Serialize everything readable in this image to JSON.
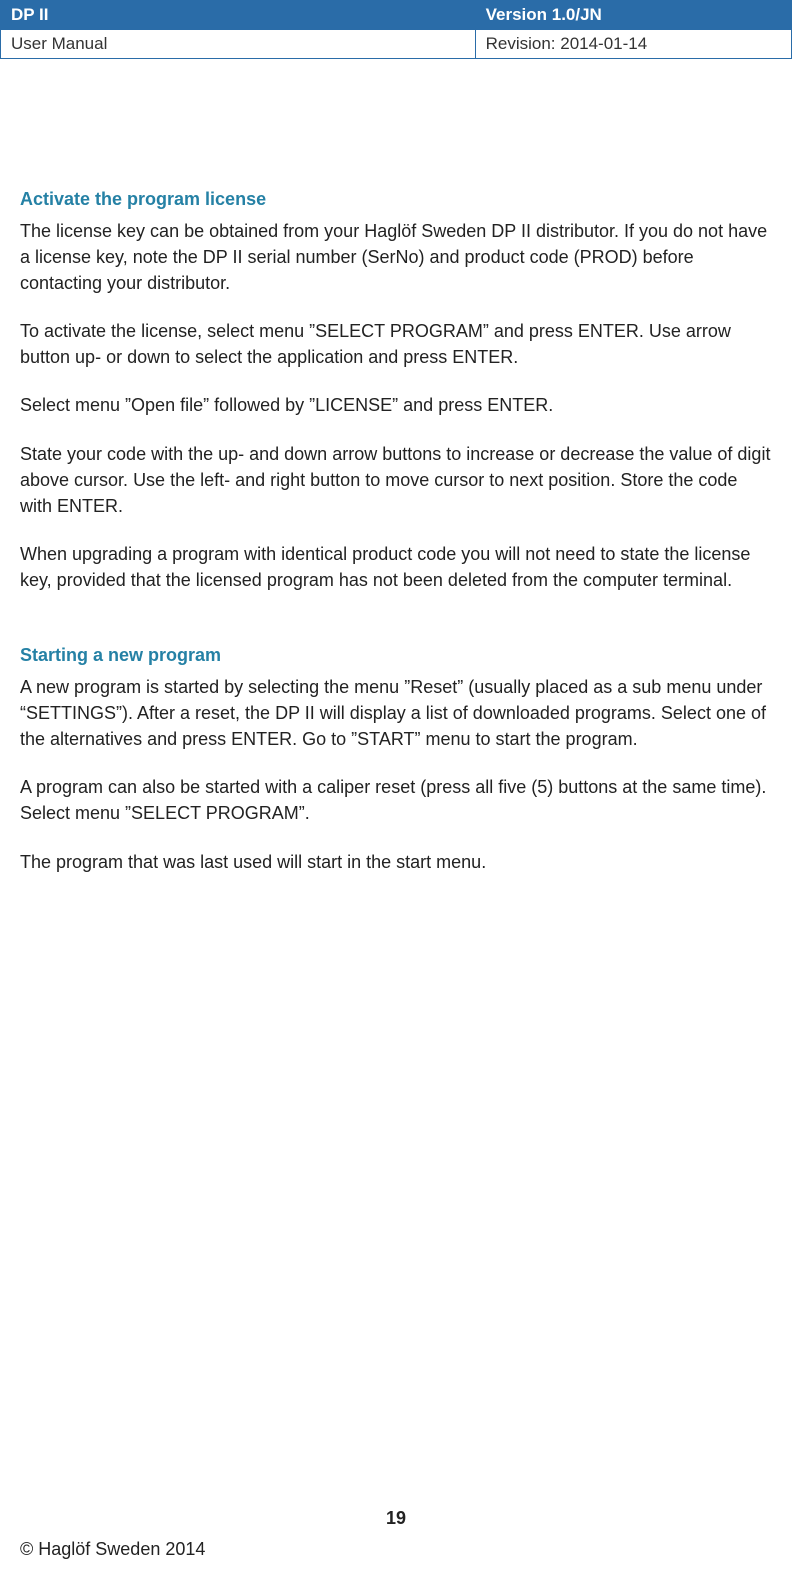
{
  "header": {
    "title": "DP II",
    "version": "Version 1.0/JN",
    "doc_type": "User Manual",
    "revision": "Revision: 2014-01-14"
  },
  "sections": [
    {
      "heading": "Activate the program license",
      "paragraphs": [
        "The license key can be obtained from your Haglöf Sweden DP II distributor. If you do not have a license key, note the DP II serial number (SerNo) and product code (PROD) before contacting your distributor.",
        "To activate the license, select menu ”SELECT PROGRAM” and press ENTER. Use arrow button up- or down to select the application and press ENTER.",
        "Select menu ”Open file” followed by ”LICENSE” and press ENTER.",
        "State your code with the up- and down arrow buttons to increase or decrease the value of digit above cursor. Use the left- and right button to move cursor to next position. Store the code with ENTER.",
        "When upgrading a program with identical product code you will not need to state the license key, provided that the licensed program has not been deleted from the computer terminal."
      ]
    },
    {
      "heading": "Starting a new program",
      "paragraphs": [
        "A new program is started by selecting the menu ”Reset” (usually placed as a sub menu under “SETTINGS”). After a reset, the DP II will display a list of downloaded programs. Select one of the alternatives and press ENTER. Go to ”START” menu to start the program.",
        "A program can also be started with a caliper reset (press all five (5) buttons at the same time). Select menu ”SELECT PROGRAM”.",
        "The program that was last used will start in the start menu."
      ]
    }
  ],
  "footer": {
    "page_number": "19",
    "copyright": "© Haglöf Sweden 2014"
  }
}
